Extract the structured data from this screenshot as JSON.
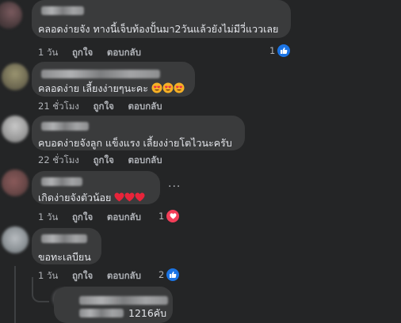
{
  "comments": [
    {
      "text": "คลอดง่ายจัง ทางนี้เจ็บท้องปั้นมา2วันแล้วยังไม่มีวี่แววเลย",
      "time": "1 วัน",
      "like": "ถูกใจ",
      "reply": "ตอบกลับ",
      "reaction_count": "1",
      "reaction_type": "like"
    },
    {
      "text": "คลอดง่าย เลี้ยงง่ายๆนะคะ",
      "emojis": [
        "heart-eyes",
        "heart-eyes",
        "heart-eyes"
      ],
      "time": "21 ชั่วโมง",
      "like": "ถูกใจ",
      "reply": "ตอบกลับ"
    },
    {
      "text": "คบอดง่ายจังลูก แข็งแรง เลี้ยงง่ายโตไวนะครับ",
      "time": "22 ชั่วโมง",
      "like": "ถูกใจ",
      "reply": "ตอบกลับ"
    },
    {
      "text": "เกิดง่ายจังตัวน้อย",
      "emojis": [
        "red-heart",
        "red-heart",
        "red-heart"
      ],
      "time": "1 วัน",
      "like": "ถูกใจ",
      "reply": "ตอบกลับ",
      "reaction_count": "1",
      "reaction_type": "love",
      "more": "···"
    },
    {
      "text": "ขอทะเลบียน",
      "time": "1 วัน",
      "like": "ถูกใจ",
      "reply": "ตอบกลับ",
      "reaction_count": "2",
      "reaction_type": "like"
    }
  ],
  "reply_preview": {
    "text": "1216คับ"
  },
  "colors": {
    "background": "#242526",
    "bubble": "#3a3b3c",
    "text": "#e4e6eb",
    "meta": "#b0b3b8",
    "like": "#1b74e4",
    "love": "#f33e58"
  }
}
